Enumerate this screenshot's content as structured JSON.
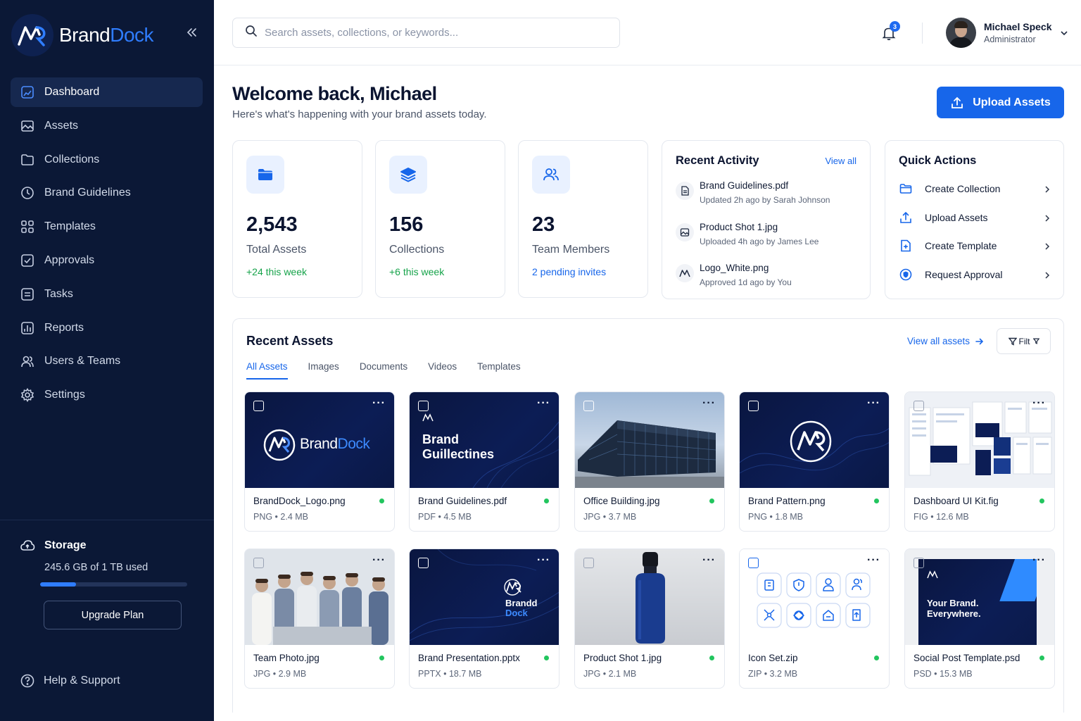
{
  "brand": {
    "name_a": "Brand",
    "name_b": "Dock"
  },
  "sidebar": {
    "items": [
      {
        "label": "Dashboard",
        "icon": "dashboard-icon"
      },
      {
        "label": "Assets",
        "icon": "image-icon"
      },
      {
        "label": "Collections",
        "icon": "folder-icon"
      },
      {
        "label": "Brand Guidelines",
        "icon": "compass-icon"
      },
      {
        "label": "Templates",
        "icon": "grid-icon"
      },
      {
        "label": "Approvals",
        "icon": "check-square-icon"
      },
      {
        "label": "Tasks",
        "icon": "list-icon"
      },
      {
        "label": "Reports",
        "icon": "bar-chart-icon"
      },
      {
        "label": "Users & Teams",
        "icon": "users-icon"
      },
      {
        "label": "Settings",
        "icon": "gear-icon"
      }
    ],
    "storage": {
      "title": "Storage",
      "used_text": "245.6 GB of 1 TB used",
      "fraction": 0.2456
    },
    "upgrade_label": "Upgrade Plan",
    "help_label": "Help & Support"
  },
  "header": {
    "search_placeholder": "Search assets, collections, or keywords...",
    "notification_count": "3",
    "user_name": "Michael Speck",
    "user_role": "Administrator"
  },
  "welcome": {
    "title": "Welcome back, Michael",
    "subtitle": "Here's what's happening with your brand assets today.",
    "upload_label": "Upload Assets"
  },
  "stats": [
    {
      "value": "2,543",
      "label": "Total Assets",
      "trend": "+24 this week"
    },
    {
      "value": "156",
      "label": "Collections",
      "trend": "+6 this week"
    },
    {
      "value": "23",
      "label": "Team Members",
      "trend": "2 pending invites"
    }
  ],
  "activity": {
    "title": "Recent Activity",
    "view_all": "View all",
    "items": [
      {
        "name": "Brand Guidelines.pdf",
        "meta": "Updated 2h ago by Sarah Johnson"
      },
      {
        "name": "Product Shot 1.jpg",
        "meta": "Uploaded 4h ago by James Lee"
      },
      {
        "name": "Logo_White.png",
        "meta": "Approved 1d ago by You"
      }
    ]
  },
  "quick_actions": {
    "title": "Quick Actions",
    "items": [
      {
        "label": "Create Collection"
      },
      {
        "label": "Upload Assets"
      },
      {
        "label": "Create Template"
      },
      {
        "label": "Request Approval"
      }
    ]
  },
  "recent_assets": {
    "title": "Recent Assets",
    "view_all": "View all assets",
    "filter_label": "Filt",
    "tabs": [
      "All Assets",
      "Images",
      "Documents",
      "Videos",
      "Templates"
    ],
    "tiles": [
      {
        "name": "BrandDock_Logo.png",
        "meta": "PNG • 2.4 MB"
      },
      {
        "name": "Brand Guidelines.pdf",
        "meta": "PDF • 4.5 MB"
      },
      {
        "name": "Office Building.jpg",
        "meta": "JPG • 3.7 MB"
      },
      {
        "name": "Brand Pattern.png",
        "meta": "PNG • 1.8 MB"
      },
      {
        "name": "Dashboard UI Kit.fig",
        "meta": "FIG • 12.6 MB"
      },
      {
        "name": "Team Photo.jpg",
        "meta": "JPG • 2.9 MB"
      },
      {
        "name": "Brand Presentation.pptx",
        "meta": "PPTX • 18.7 MB"
      },
      {
        "name": "Product Shot 1.jpg",
        "meta": "JPG • 2.1 MB"
      },
      {
        "name": "Icon Set.zip",
        "meta": "ZIP • 3.2 MB"
      },
      {
        "name": "Social Post Template.psd",
        "meta": "PSD • 15.3 MB"
      }
    ],
    "thumb_text": {
      "logo_a": "Brand",
      "logo_b": "Dock",
      "guidelines": "Brand Guillectines",
      "presentation_a": "Brandd",
      "presentation_b": "Dock",
      "social": "Your Brand. Everywhere."
    }
  },
  "colors": {
    "sidebar": "#0b1836",
    "accent": "#1766ea",
    "success": "#22c55e"
  }
}
